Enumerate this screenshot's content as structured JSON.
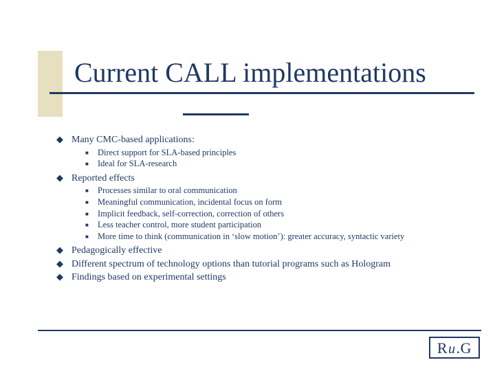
{
  "title": "Current CALL implementations",
  "bullets": [
    {
      "text": "Many CMC-based applications:",
      "sub": [
        "Direct support for SLA-based principles",
        "Ideal for SLA-research"
      ]
    },
    {
      "text": "Reported effects",
      "sub": [
        "Processes similar to oral communication",
        "Meaningful communication, incidental focus on form",
        "Implicit feedback, self-correction, correction of others",
        "Less teacher control, more student participation",
        "More time to think (communication in ‘slow motion’): greater accuracy, syntactic variety"
      ]
    },
    {
      "text": "Pedagogically effective",
      "sub": []
    },
    {
      "text": "Different spectrum of technology options than tutorial programs such as Hologram",
      "sub": []
    },
    {
      "text": "Findings based on experimental settings",
      "sub": []
    }
  ],
  "logo": {
    "r": "R",
    "u": "u",
    "g": ".G"
  }
}
